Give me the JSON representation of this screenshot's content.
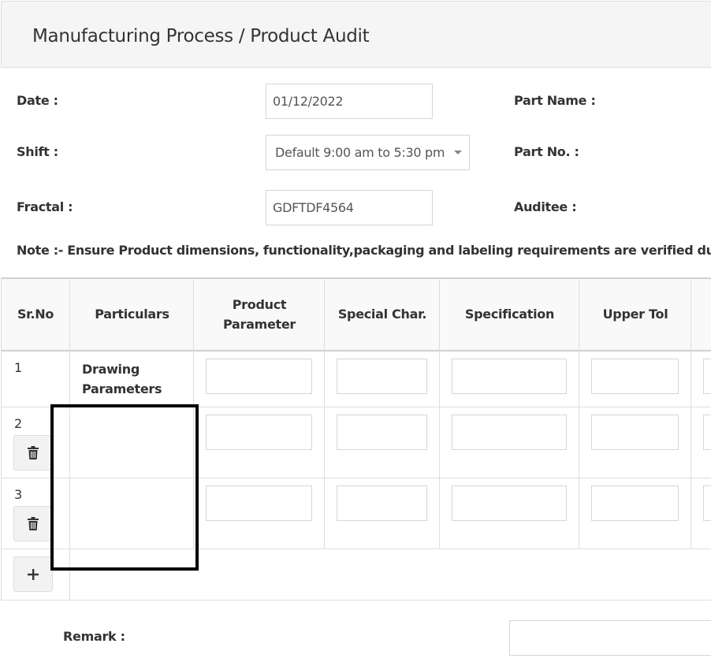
{
  "header": {
    "title": "Manufacturing Process / Product Audit"
  },
  "form": {
    "date_label": "Date :",
    "date_value": "01/12/2022",
    "shift_label": "Shift :",
    "shift_value": "Default 9:00 am to 5:30 pm",
    "fractal_label": "Fractal :",
    "fractal_value": "GDFTDF4564",
    "part_name_label": "Part Name :",
    "part_no_label": "Part No. :",
    "auditee_label": "Auditee :"
  },
  "note": "Note :- Ensure Product dimensions, functionality,packaging and labeling requirements are verified during",
  "table": {
    "columns": [
      "Sr.No",
      "Particulars",
      "Product Parameter",
      "Special Char.",
      "Specification",
      "Upper Tol"
    ],
    "rows": [
      {
        "sr": "1",
        "particulars": "Drawing Parameters"
      },
      {
        "sr": "2",
        "particulars": ""
      },
      {
        "sr": "3",
        "particulars": ""
      }
    ]
  },
  "icons": {
    "delete": "trash-icon",
    "add": "plus-icon"
  },
  "remark_label": "Remark :"
}
